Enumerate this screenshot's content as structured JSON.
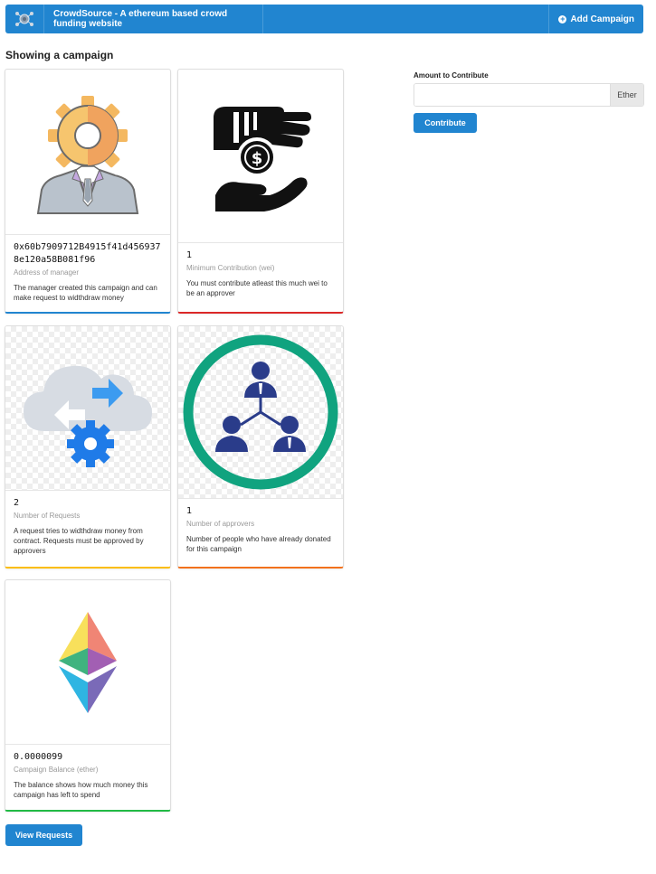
{
  "nav": {
    "brand": "CrowdSource - A ethereum based crowd funding website",
    "add_campaign": "Add Campaign"
  },
  "page": {
    "title": "Showing a campaign"
  },
  "cards": [
    {
      "header": "0x60b7909712B4915f41d4569378e120a58B081f96",
      "meta": "Address of manager",
      "description": "The manager created this campaign and can make request to widthdraw money",
      "image": "manager-gear-icon"
    },
    {
      "header": "1",
      "meta": "Minimum Contribution (wei)",
      "description": "You must contribute atleast this much wei to be an approver",
      "image": "money-hands-icon"
    },
    {
      "header": "2",
      "meta": "Number of Requests",
      "description": "A request tries to widthdraw money from contract. Requests must be approved by approvers",
      "image": "cloud-transfer-icon"
    },
    {
      "header": "1",
      "meta": "Number of approvers",
      "description": "Number of people who have already donated for this campaign",
      "image": "people-network-icon"
    },
    {
      "header": "0.0000099",
      "meta": "Campaign Balance (ether)",
      "description": "The balance shows how much money this campaign has left to spend",
      "image": "ethereum-logo-icon"
    }
  ],
  "form": {
    "label": "Amount to Contribute",
    "value": "",
    "unit": "Ether",
    "submit": "Contribute"
  },
  "view_requests": "View Requests",
  "colors": {
    "primary": "#2185d0",
    "card_border_blue": "#2185d0",
    "card_border_red": "#db2828",
    "card_border_yellow": "#fbbd08",
    "card_border_orange": "#f2711c",
    "card_border_green": "#21ba45"
  }
}
